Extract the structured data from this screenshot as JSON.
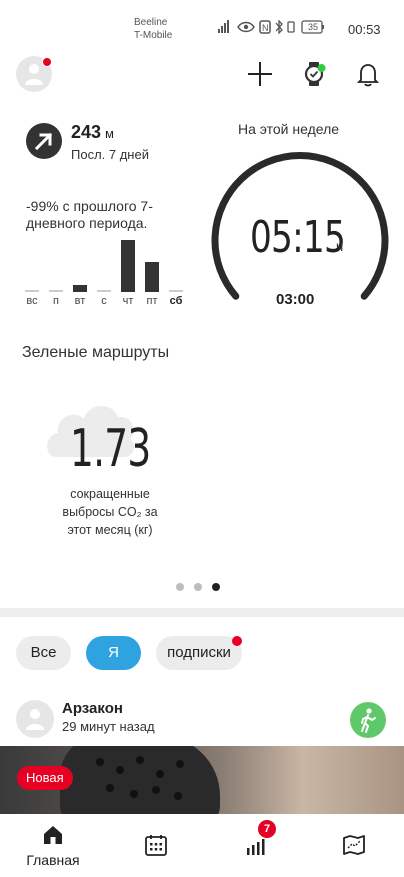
{
  "status_bar": {
    "carrier_1": "Beeline",
    "carrier_2": "T-Mobile",
    "battery": "35",
    "time": "00:53"
  },
  "weekly": {
    "distance_value": "243",
    "distance_unit": "м",
    "period_label": "Посл. 7 дней",
    "change_text": "-99% с прошлого 7-дневного периода.",
    "bar_chart": {
      "days": [
        "вс",
        "п",
        "вт",
        "с",
        "чт",
        "пт",
        "сб"
      ],
      "today_index": 6,
      "relative_values": [
        0,
        0,
        0.14,
        0,
        1.0,
        0.58,
        0
      ]
    },
    "week_title": "На этой неделе",
    "duration_value": "05:15",
    "duration_unit": "ч",
    "target_value": "03:00"
  },
  "green_routes": {
    "title": "Зеленые маршруты",
    "co2_value": "1.73",
    "co2_desc_line1": "сокращенные",
    "co2_desc_line2": "выбросы CO₂ за",
    "co2_desc_line3": "этот месяц (кг)"
  },
  "pager": {
    "count": 3,
    "active_index": 2
  },
  "filters": {
    "all": "Все",
    "me": "Я",
    "subscriptions": "подписки"
  },
  "feed": {
    "user_name": "Арзакон",
    "time_ago": "29 минут назад",
    "badge": "Новая",
    "activity_icon": "walking-icon"
  },
  "bottom_nav": {
    "home_label": "Главная",
    "calendar_icon": "calendar-icon",
    "stats_icon": "bar-chart-icon",
    "stats_badge": "7",
    "map_icon": "map-icon"
  },
  "colors": {
    "accent_blue": "#2fa3e0",
    "alert_red": "#e60023",
    "activity_green": "#5ec86b",
    "text_dark": "#222222"
  }
}
